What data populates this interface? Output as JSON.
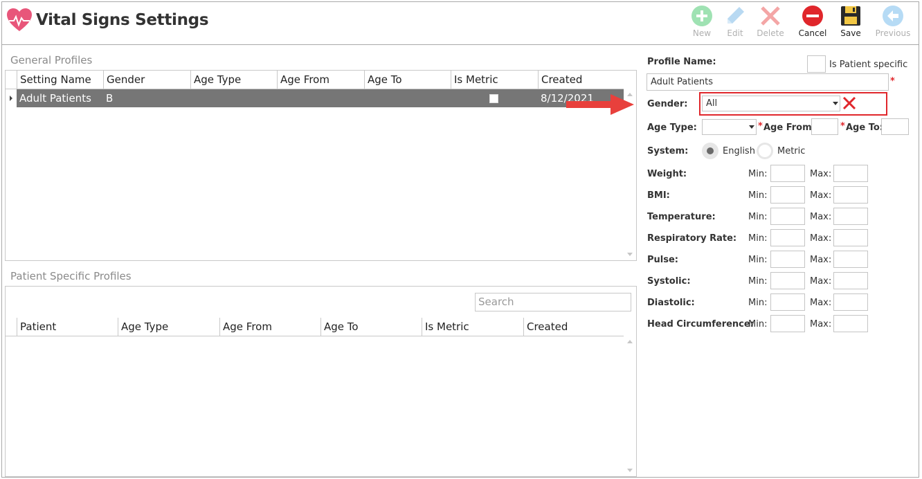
{
  "window": {
    "title": "Vital Signs Settings"
  },
  "toolbar": {
    "new": "New",
    "edit": "Edit",
    "delete": "Delete",
    "cancel": "Cancel",
    "save": "Save",
    "previous": "Previous"
  },
  "general_profiles": {
    "title": "General Profiles",
    "columns": [
      "Setting Name",
      "Gender",
      "Age Type",
      "Age From",
      "Age To",
      "Is Metric",
      "Created"
    ],
    "rows": [
      {
        "setting_name": "Adult Patients",
        "gender": "B",
        "age_type": "",
        "age_from": "",
        "age_to": "",
        "is_metric": false,
        "created": "8/12/2021"
      }
    ]
  },
  "patient_profiles": {
    "title": "Patient Specific Profiles",
    "search_placeholder": "Search",
    "columns": [
      "Patient",
      "Age Type",
      "Age From",
      "Age To",
      "Is Metric",
      "Created"
    ]
  },
  "form": {
    "profile_name_label": "Profile Name:",
    "is_patient_specific_label": "Is Patient specific",
    "profile_name_value": "Adult Patients",
    "gender_label": "Gender:",
    "gender_value": "All",
    "age_type_label": "Age Type:",
    "age_from_label": "Age From:",
    "age_to_label": "Age To:",
    "system_label": "System:",
    "system_options": [
      "English",
      "Metric"
    ],
    "system_selected": "English",
    "min_label": "Min:",
    "max_label": "Max:",
    "vitals": [
      "Weight:",
      "BMI:",
      "Temperature:",
      "Respiratory Rate:",
      "Pulse:",
      "Systolic:",
      "Diastolic:",
      "Head Circumference:"
    ]
  },
  "colors": {
    "highlight": "#e0262b",
    "selected_row": "#767676",
    "accent_green": "#7ed99c",
    "accent_blue": "#8fc3ea"
  }
}
